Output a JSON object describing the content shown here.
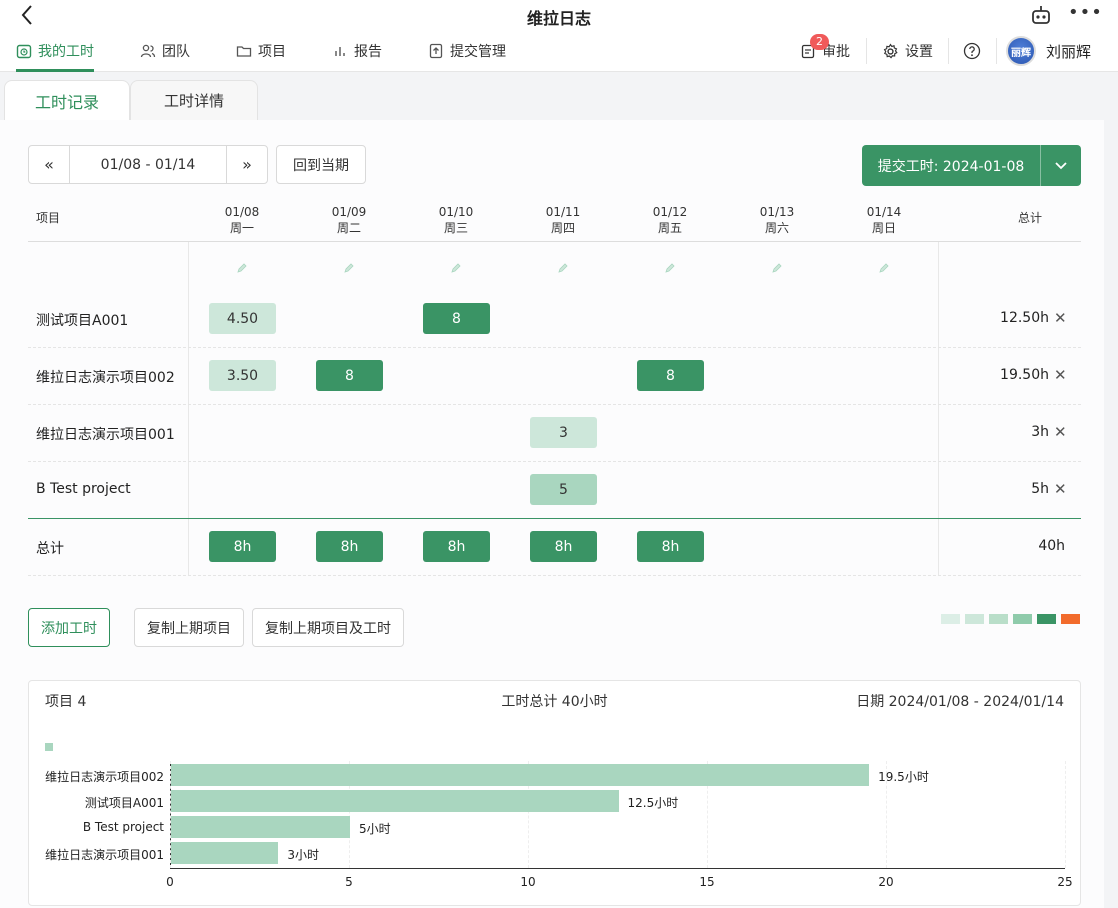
{
  "window": {
    "title": "维拉日志"
  },
  "nav": {
    "items": [
      {
        "label": "我的工时",
        "icon": "clock-calendar-icon",
        "active": true
      },
      {
        "label": "团队",
        "icon": "team-icon"
      },
      {
        "label": "项目",
        "icon": "folder-icon"
      },
      {
        "label": "报告",
        "icon": "bar-chart-icon"
      },
      {
        "label": "提交管理",
        "icon": "upload-doc-icon"
      }
    ],
    "approve": {
      "label": "审批",
      "badge": "2"
    },
    "settings": {
      "label": "设置"
    },
    "user": {
      "name": "刘丽辉",
      "avatar_text": "丽辉"
    }
  },
  "tabs": [
    {
      "label": "工时记录",
      "active": true
    },
    {
      "label": "工时详情"
    }
  ],
  "toolbar": {
    "range": "01/08 - 01/14",
    "prev": "«",
    "next": "»",
    "back_to_current": "回到当期",
    "submit": "提交工时: 2024-01-08"
  },
  "grid": {
    "project_header": "项目",
    "total_header": "总计",
    "days": [
      {
        "date": "01/08",
        "weekday": "周一"
      },
      {
        "date": "01/09",
        "weekday": "周二"
      },
      {
        "date": "01/10",
        "weekday": "周三"
      },
      {
        "date": "01/11",
        "weekday": "周四"
      },
      {
        "date": "01/12",
        "weekday": "周五"
      },
      {
        "date": "01/13",
        "weekday": "周六"
      },
      {
        "date": "01/14",
        "weekday": "周日"
      }
    ],
    "rows": [
      {
        "project": "测试项目A001",
        "cells": [
          "4.50",
          "",
          "8",
          "",
          "",
          "",
          ""
        ],
        "shade": [
          "light",
          "",
          "dark",
          "",
          "",
          "",
          ""
        ],
        "total": "12.50h"
      },
      {
        "project": "维拉日志演示项目002",
        "cells": [
          "3.50",
          "8",
          "",
          "",
          "8",
          "",
          ""
        ],
        "shade": [
          "light",
          "dark",
          "",
          "",
          "dark",
          "",
          ""
        ],
        "total": "19.50h"
      },
      {
        "project": "维拉日志演示项目001",
        "cells": [
          "",
          "",
          "",
          "3",
          "",
          "",
          ""
        ],
        "shade": [
          "",
          "",
          "",
          "light",
          "",
          "",
          ""
        ],
        "total": "3h"
      },
      {
        "project": "B Test project",
        "cells": [
          "",
          "",
          "",
          "5",
          "",
          "",
          ""
        ],
        "shade": [
          "",
          "",
          "",
          "mid",
          "",
          "",
          ""
        ],
        "total": "5h"
      }
    ],
    "totals_label": "总计",
    "totals": [
      "8h",
      "8h",
      "8h",
      "8h",
      "8h",
      "",
      ""
    ],
    "grand_total": "40h"
  },
  "actions": {
    "add": "添加工时",
    "copy_projects": "复制上期项目",
    "copy_projects_hours": "复制上期项目及工时"
  },
  "legend_colors": [
    "#dceee6",
    "#cde7da",
    "#b9dec9",
    "#8fcbab",
    "#3a9465",
    "#f26b2c"
  ],
  "stats": {
    "projects": "项目 4",
    "total": "工时总计 40小时",
    "dates": "日期 2024/01/08 - 2024/01/14"
  },
  "chart_data": {
    "type": "bar",
    "orientation": "horizontal",
    "categories": [
      "维拉日志演示项目002",
      "测试项目A001",
      "B Test project",
      "维拉日志演示项目001"
    ],
    "values": [
      19.5,
      12.5,
      5,
      3
    ],
    "value_labels": [
      "19.5小时",
      "12.5小时",
      "5小时",
      "3小时"
    ],
    "xlim": [
      0,
      25
    ],
    "xticks": [
      0,
      5,
      10,
      15,
      20,
      25
    ],
    "color": "#a9d6bf"
  }
}
